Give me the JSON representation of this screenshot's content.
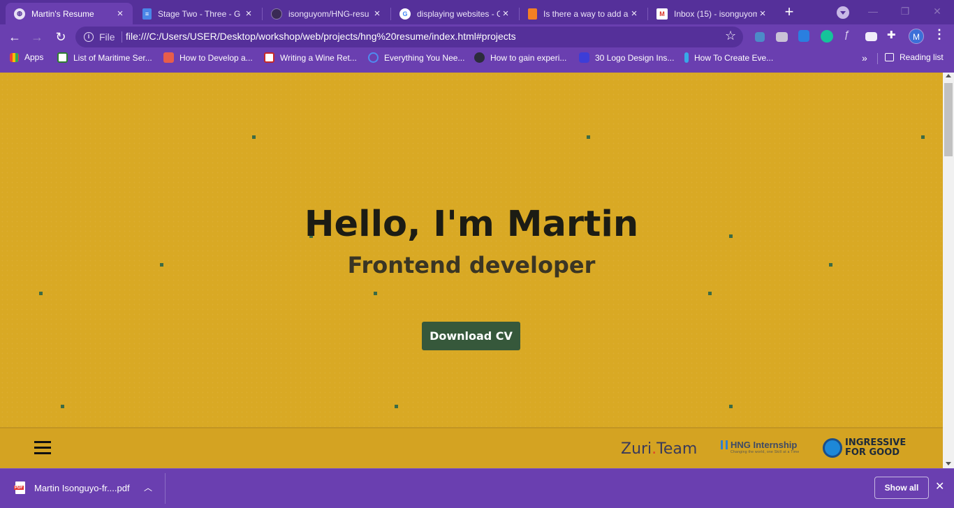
{
  "browser": {
    "tabs": [
      {
        "title": "Martin's Resume",
        "favicon": "globe-icon",
        "active": true
      },
      {
        "title": "Stage Two - Three - G",
        "favicon": "docs-icon",
        "active": false
      },
      {
        "title": "isonguyom/HNG-resu",
        "favicon": "github-icon",
        "active": false
      },
      {
        "title": "displaying websites - G",
        "favicon": "google-icon",
        "active": false
      },
      {
        "title": "Is there a way to add a",
        "favicon": "stackoverflow-icon",
        "active": false
      },
      {
        "title": "Inbox (15) - isonguyom",
        "favicon": "gmail-icon",
        "active": false
      }
    ],
    "address_scheme": "File",
    "url": "file:///C:/Users/USER/Desktop/workshop/web/projects/hng%20resume/index.html#projects",
    "profile_initial": "M",
    "bookmarks": [
      {
        "label": "Apps",
        "icon": "apps-icon"
      },
      {
        "label": "List of Maritime Ser...",
        "icon": "bookmark-icon"
      },
      {
        "label": "How to Develop a...",
        "icon": "bookmark-icon"
      },
      {
        "label": "Writing a Wine Ret...",
        "icon": "bookmark-icon"
      },
      {
        "label": "Everything You Nee...",
        "icon": "bookmark-icon"
      },
      {
        "label": "How to gain experi...",
        "icon": "bookmark-icon"
      },
      {
        "label": "30 Logo Design Ins...",
        "icon": "bookmark-icon"
      },
      {
        "label": "How To Create Eve...",
        "icon": "bookmark-icon"
      }
    ],
    "bookmarks_more": "»",
    "reading_list": "Reading list"
  },
  "page": {
    "hero_title": "Hello, I'm Martin",
    "hero_subtitle": "Frontend developer",
    "download_button": "Download CV",
    "footer_logos": {
      "zuri_part1": "Zuri",
      "zuri_dot": ".",
      "zuri_part2": "Team",
      "hng": "HNG Internship",
      "hng_tagline": "Changing the world, one Skill at a Time",
      "i4g_line1": "INGRESSIVE",
      "i4g_line2": "FOR GOOD"
    }
  },
  "downloads": {
    "file_name": "Martin Isonguyo-fr....pdf",
    "show_all": "Show all"
  },
  "colors": {
    "browser_frame": "#6a3fb0",
    "page_background": "#d9a924",
    "button": "#36583b"
  }
}
